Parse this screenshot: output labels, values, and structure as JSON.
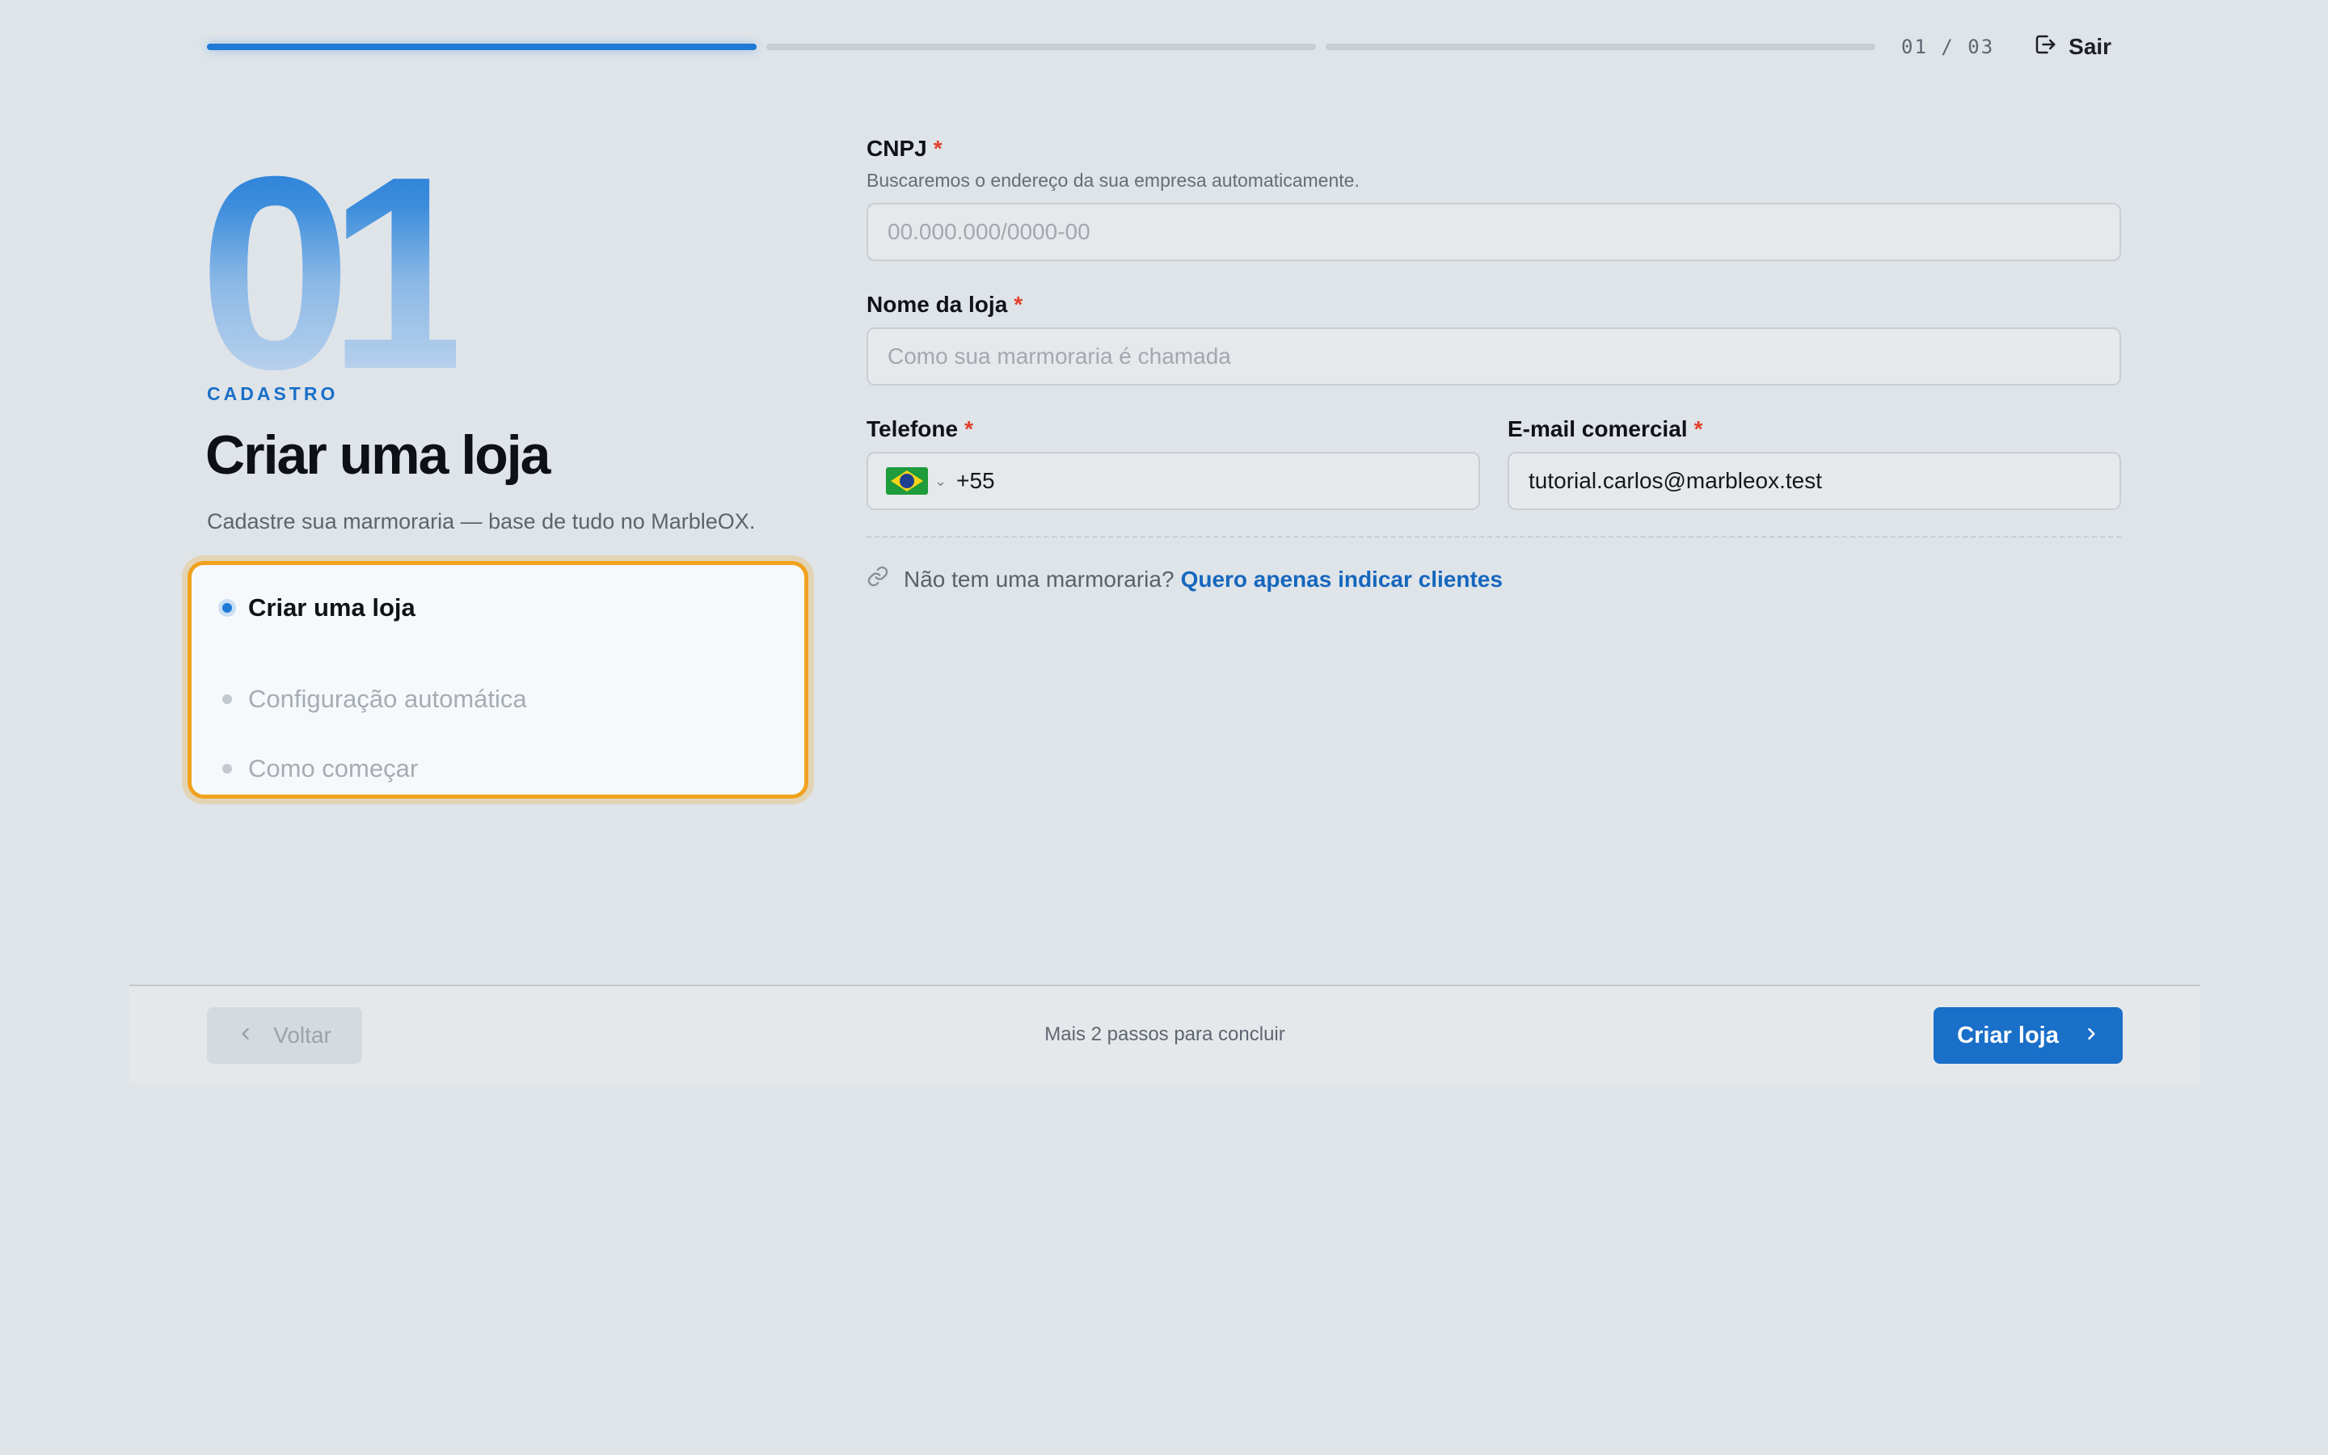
{
  "progress": {
    "segments": [
      true,
      false,
      false
    ],
    "counter": "01 / 03",
    "exit_label": "Sair"
  },
  "intro": {
    "step_number": "01",
    "eyebrow": "CADASTRO",
    "title": "Criar uma loja",
    "subtitle": "Cadastre sua marmoraria — base de tudo no MarbleOX."
  },
  "steps": [
    {
      "label": "Criar uma loja",
      "active": true
    },
    {
      "label": "Configuração automática",
      "active": false
    },
    {
      "label": "Como começar",
      "active": false
    }
  ],
  "form": {
    "cnpj": {
      "label": "CNPJ",
      "required": "*",
      "hint": "Buscaremos o endereço da sua empresa automaticamente.",
      "placeholder": "00.000.000/0000-00",
      "value": ""
    },
    "store_name": {
      "label": "Nome da loja",
      "required": "*",
      "placeholder": "Como sua marmoraria é chamada",
      "value": ""
    },
    "phone": {
      "label": "Telefone",
      "required": "*",
      "country_icon": "brazil-flag-icon",
      "value": "+55"
    },
    "email": {
      "label": "E-mail comercial",
      "required": "*",
      "value": "tutorial.carlos@marbleox.test"
    },
    "alt": {
      "text": "Não tem uma marmoraria?",
      "link": "Quero apenas indicar clientes"
    }
  },
  "footer": {
    "back_label": "Voltar",
    "note": "Mais 2 passos para concluir",
    "primary_label": "Criar loja"
  },
  "colors": {
    "accent": "#1a6fc8",
    "highlight": "#f0a21e",
    "required": "#e0402a",
    "background": "#dfe4e9"
  }
}
